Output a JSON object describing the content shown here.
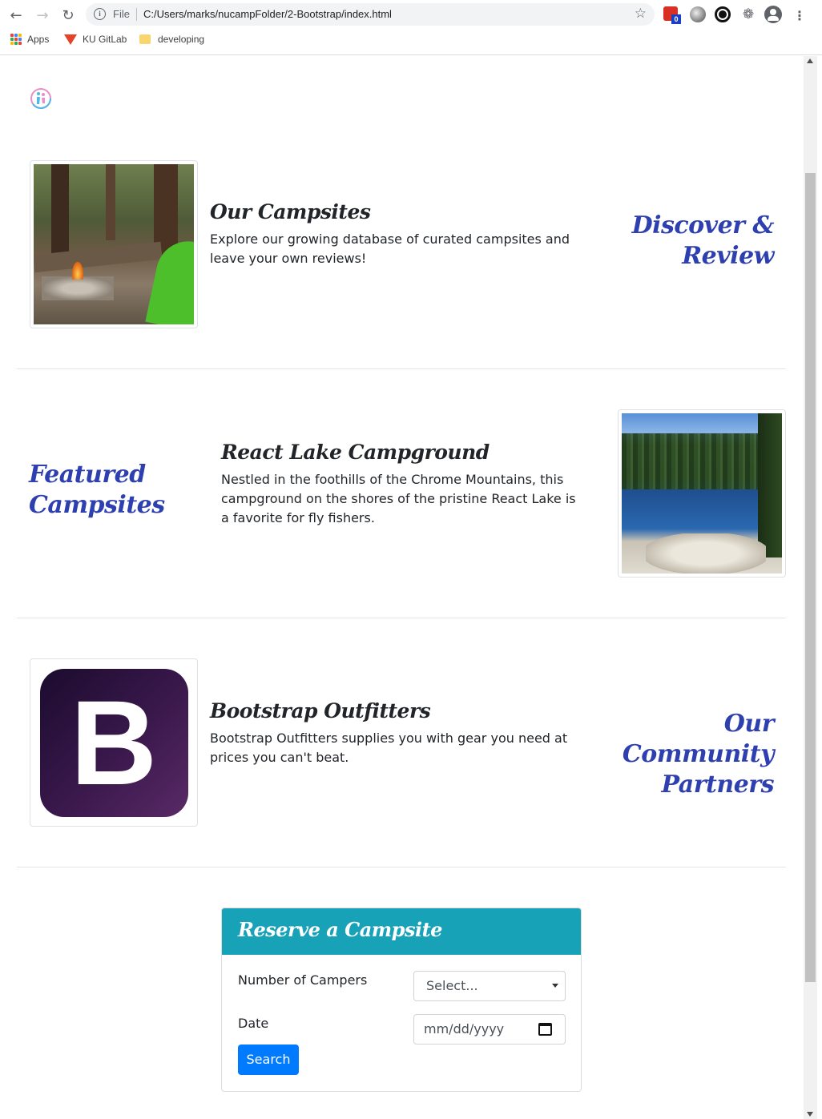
{
  "browser": {
    "file_label": "File",
    "url": "C:/Users/marks/nucampFolder/2-Bootstrap/index.html",
    "extension_badge": "0",
    "bookmarks": [
      {
        "label": "Apps"
      },
      {
        "label": "KU GitLab"
      },
      {
        "label": "developing"
      }
    ]
  },
  "sections": {
    "campsites": {
      "title": "Our Campsites",
      "text": "Explore our growing database of curated campsites and leave your own reviews!",
      "side_heading_line1": "Discover &",
      "side_heading_line2": "Review"
    },
    "featured": {
      "title": "React Lake Campground",
      "text": "Nestled in the foothills of the Chrome Mountains, this campground on the shores of the pristine React Lake is a favorite for fly fishers.",
      "side_heading_line1": "Featured",
      "side_heading_line2": "Campsites"
    },
    "partners": {
      "title": "Bootstrap Outfitters",
      "text": "Bootstrap Outfitters supplies you with gear you need at prices you can't beat.",
      "side_heading_line1": "Our Community",
      "side_heading_line2": "Partners",
      "logo_letter": "B"
    }
  },
  "reserve": {
    "title": "Reserve a Campsite",
    "campers_label": "Number of Campers",
    "campers_value": "Select...",
    "date_label": "Date",
    "date_placeholder": "mm/dd/yyyy",
    "search_label": "Search"
  },
  "colors": {
    "accent_heading": "#2e3fb0",
    "card_header": "#17a2b8",
    "primary_button": "#007bff"
  }
}
